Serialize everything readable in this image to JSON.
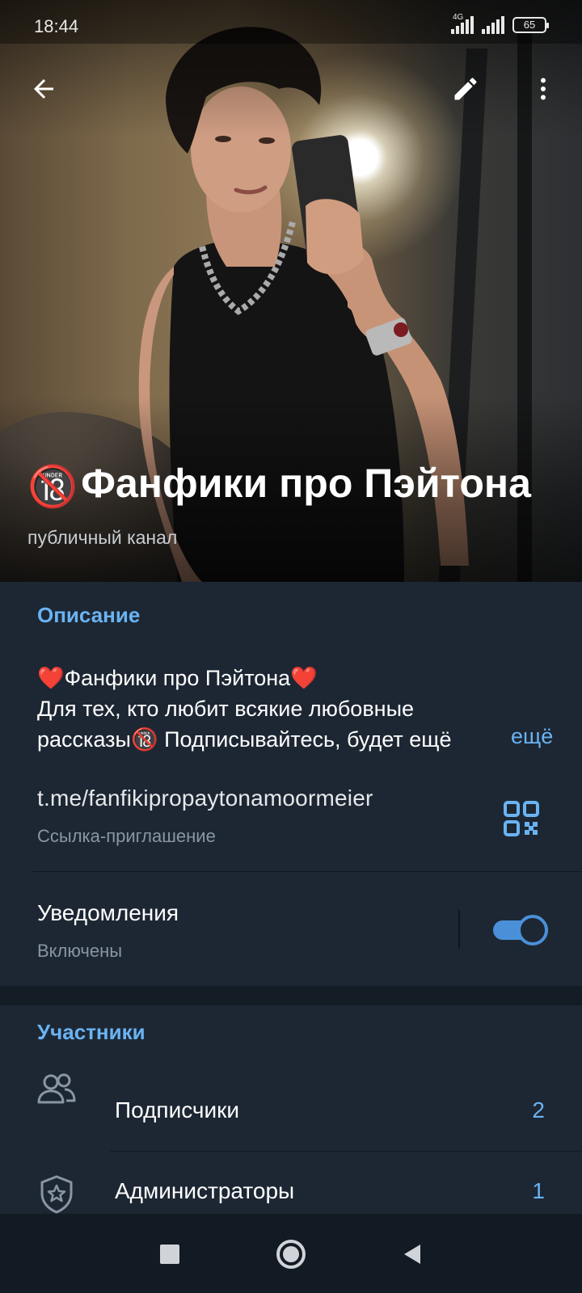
{
  "status_bar": {
    "time": "18:44",
    "network_type": "4G",
    "battery": "65"
  },
  "header": {
    "icons": {
      "back": "arrow-left-icon",
      "edit": "pencil-icon",
      "more": "more-vertical-icon"
    },
    "title_badge": "🔞",
    "title": "Фанфики про Пэйтона",
    "subtitle": "публичный канал"
  },
  "info": {
    "description_heading": "Описание",
    "description_heart_left": "❤️",
    "description_line1": "Фанфики про Пэйтона",
    "description_heart_right": "❤️",
    "description_line2": "Для тех, кто любит всякие любовные",
    "description_line3_a": "рассказы",
    "description_line3_badge": "🔞",
    "description_line3_b": " Подписывайтесь, будет ещё",
    "more_label": "ещё",
    "invite_link": "t.me/fanfikipropaytonamoormeier",
    "invite_caption": "Ссылка-приглашение",
    "notifications_label": "Уведомления",
    "notifications_status": "Включены",
    "notifications_enabled": true
  },
  "members": {
    "heading": "Участники",
    "rows": [
      {
        "label": "Подписчики",
        "count": "2",
        "icon": "users-icon"
      },
      {
        "label": "Администраторы",
        "count": "1",
        "icon": "shield-star-icon"
      }
    ]
  },
  "colors": {
    "accent": "#6ab3f3",
    "toggle": "#4a90d9",
    "background": "#1d2733",
    "muted": "#8a96a3"
  },
  "nav_bar": {
    "icons": [
      "square-recents-icon",
      "circle-home-icon",
      "triangle-back-icon"
    ]
  }
}
